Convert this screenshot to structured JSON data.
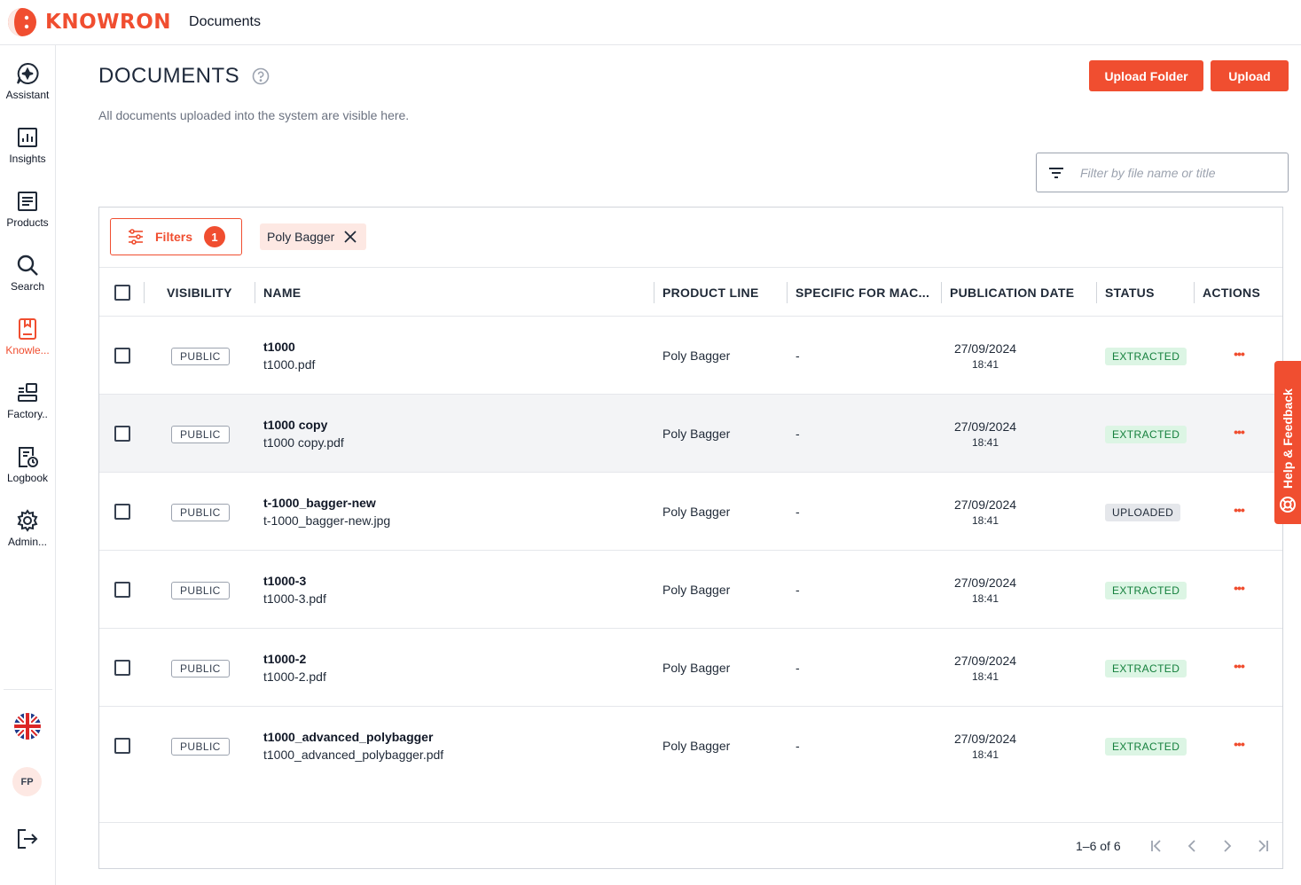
{
  "brand": {
    "name": "KNOWRON",
    "color": "#f04e30"
  },
  "topbar": {
    "title": "Documents"
  },
  "sidebar": {
    "items": [
      {
        "label": "Assistant",
        "icon": "assistant-icon"
      },
      {
        "label": "Insights",
        "icon": "insights-icon"
      },
      {
        "label": "Products",
        "icon": "products-icon"
      },
      {
        "label": "Search",
        "icon": "search-icon"
      },
      {
        "label": "Knowle...",
        "icon": "knowledge-icon",
        "active": true
      },
      {
        "label": "Factory..",
        "icon": "factory-icon"
      },
      {
        "label": "Logbook",
        "icon": "logbook-icon"
      },
      {
        "label": "Admin...",
        "icon": "gear-icon"
      }
    ],
    "language_icon": "uk-flag-icon",
    "avatar_initials": "FP",
    "logout_icon": "logout-icon"
  },
  "page": {
    "title": "DOCUMENTS",
    "subtitle": "All documents uploaded into the system are visible here.",
    "upload_folder_label": "Upload Folder",
    "upload_label": "Upload",
    "filter_placeholder": "Filter by file name or title"
  },
  "filters": {
    "label": "Filters",
    "count": "1",
    "chips": [
      {
        "label": "Poly Bagger"
      }
    ]
  },
  "table": {
    "columns": {
      "visibility": "VISIBILITY",
      "name": "NAME",
      "product_line": "PRODUCT LINE",
      "specific": "SPECIFIC FOR MAC...",
      "publication_date": "PUBLICATION DATE",
      "status": "STATUS",
      "actions": "ACTIONS"
    },
    "rows": [
      {
        "visibility": "PUBLIC",
        "title": "t1000",
        "file": "t1000.pdf",
        "product_line": "Poly Bagger",
        "specific": "-",
        "date": "27/09/2024",
        "time": "18:41",
        "status": "EXTRACTED",
        "actions": "•••"
      },
      {
        "visibility": "PUBLIC",
        "title": "t1000 copy",
        "file": "t1000 copy.pdf",
        "product_line": "Poly Bagger",
        "specific": "-",
        "date": "27/09/2024",
        "time": "18:41",
        "status": "EXTRACTED",
        "actions": "•••"
      },
      {
        "visibility": "PUBLIC",
        "title": "t-1000_bagger-new",
        "file": "t-1000_bagger-new.jpg",
        "product_line": "Poly Bagger",
        "specific": "-",
        "date": "27/09/2024",
        "time": "18:41",
        "status": "UPLOADED",
        "actions": "•••"
      },
      {
        "visibility": "PUBLIC",
        "title": "t1000-3",
        "file": "t1000-3.pdf",
        "product_line": "Poly Bagger",
        "specific": "-",
        "date": "27/09/2024",
        "time": "18:41",
        "status": "EXTRACTED",
        "actions": "•••"
      },
      {
        "visibility": "PUBLIC",
        "title": "t1000-2",
        "file": "t1000-2.pdf",
        "product_line": "Poly Bagger",
        "specific": "-",
        "date": "27/09/2024",
        "time": "18:41",
        "status": "EXTRACTED",
        "actions": "•••"
      },
      {
        "visibility": "PUBLIC",
        "title": "t1000_advanced_polybagger",
        "file": "t1000_advanced_polybagger.pdf",
        "product_line": "Poly Bagger",
        "specific": "-",
        "date": "27/09/2024",
        "time": "18:41",
        "status": "EXTRACTED",
        "actions": "•••"
      }
    ]
  },
  "pagination": {
    "range": "1–6 of 6"
  },
  "help_tab": {
    "label": "Help & Feedback"
  }
}
